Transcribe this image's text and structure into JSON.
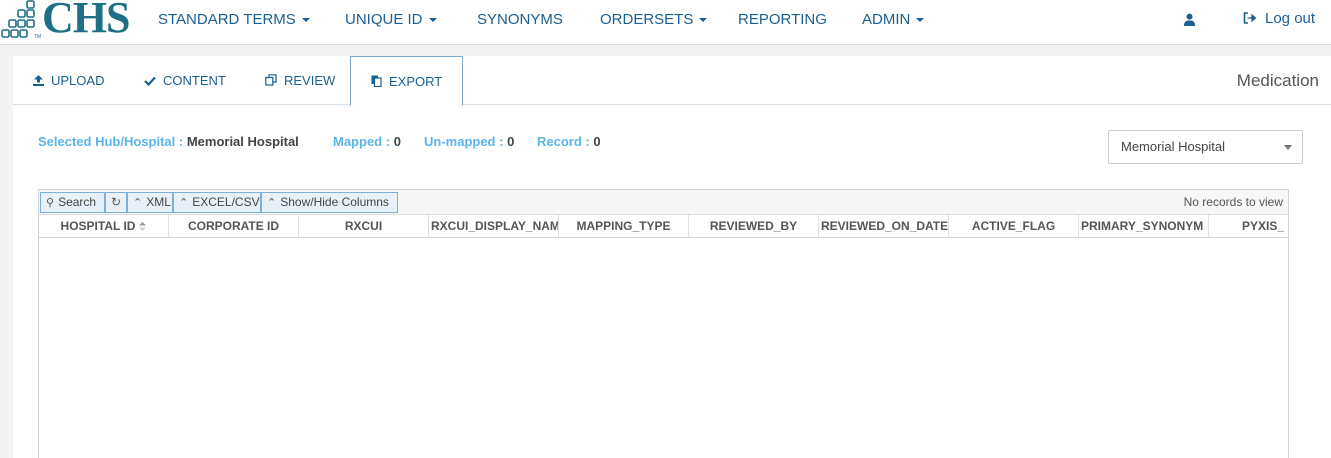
{
  "logo": {
    "text": "CHS",
    "tm": "TM"
  },
  "nav": {
    "items": [
      {
        "label": "STANDARD TERMS",
        "dropdown": true
      },
      {
        "label": "UNIQUE ID",
        "dropdown": true
      },
      {
        "label": "SYNONYMS",
        "dropdown": false
      },
      {
        "label": "ORDERSETS",
        "dropdown": true
      },
      {
        "label": "REPORTING",
        "dropdown": false
      },
      {
        "label": "ADMIN",
        "dropdown": true
      }
    ],
    "user_icon": "user-icon",
    "logout_label": "Log out",
    "logout_icon": "sign-out-icon"
  },
  "tabs": [
    {
      "label": "UPLOAD",
      "icon": "upload-icon",
      "active": false
    },
    {
      "label": "CONTENT",
      "icon": "check-icon",
      "active": false
    },
    {
      "label": "REVIEW",
      "icon": "copy-icon",
      "active": false
    },
    {
      "label": "EXPORT",
      "icon": "file-copy-icon",
      "active": true
    }
  ],
  "module_title": "Medication",
  "info": {
    "hub_label": "Selected Hub/Hospital :",
    "hub_value": "Memorial Hospital",
    "mapped_label": "Mapped :",
    "mapped_value": "0",
    "unmapped_label": "Un-mapped :",
    "unmapped_value": "0",
    "record_label": "Record :",
    "record_value": "0"
  },
  "hospital_select": {
    "selected": "Memorial Hospital"
  },
  "grid": {
    "toolbar": {
      "search": "Search",
      "refresh_icon": "refresh-icon",
      "xml": "XML",
      "excel": "EXCEL/CSV",
      "columns": "Show/Hide Columns"
    },
    "status": "No records to view",
    "columns": [
      "HOSPITAL ID",
      "CORPORATE ID",
      "RXCUI",
      "RXCUI_DISPLAY_NAME",
      "MAPPING_TYPE",
      "REVIEWED_BY",
      "REVIEWED_ON_DATE",
      "ACTIVE_FLAG",
      "PRIMARY_SYNONYM",
      "PYXIS_"
    ],
    "rows": []
  },
  "colors": {
    "brand": "#1f6f86",
    "link": "#1a5f91",
    "info_label": "#5bb5e8"
  }
}
